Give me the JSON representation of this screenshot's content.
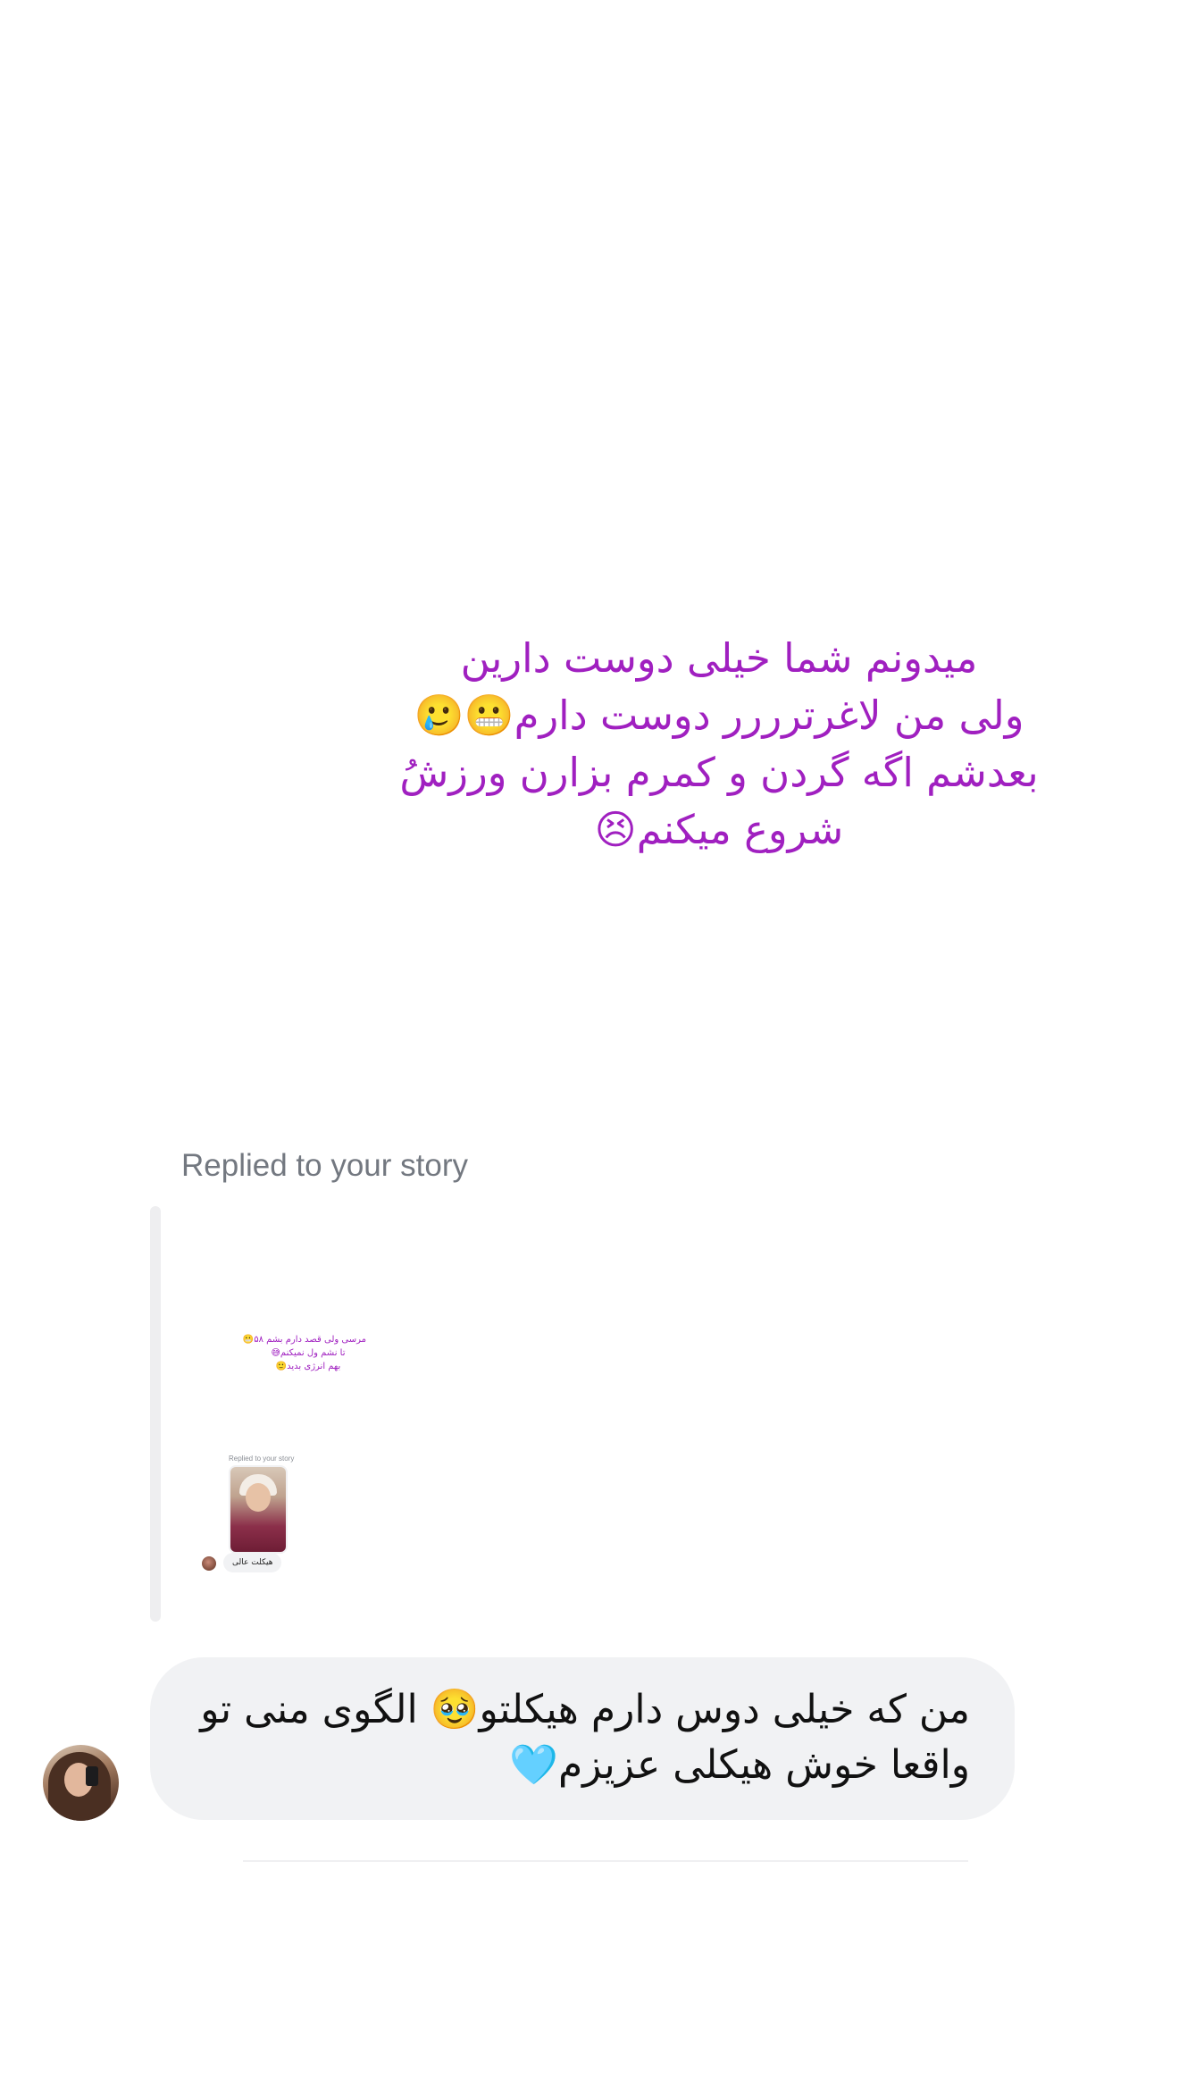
{
  "story": {
    "caption_lines": [
      "میدونم شما خیلی دوست دارین",
      "ولی من لاغرترررر دوست دارم😬🥲",
      "بعدشم اگه گردن و کمرم بزارن ورزشُ",
      "شروع میکنم😣"
    ],
    "caption_color": "#a020c0"
  },
  "reply": {
    "label": "Replied to your story",
    "quoted_preview": {
      "caption_lines": [
        "مرسی ولی قصد دارم بشم ۵۸😬",
        "تا نشم ول نمیکنم😅",
        "بهم انرژی بدید🙂"
      ],
      "replied_label": "Replied to your story",
      "message": "هیکلت عالی"
    }
  },
  "message": {
    "lines": [
      "من که خیلی دوس دارم هیکلتو🥹 الگوی منی تو",
      "واقعا خوش هیکلی عزیزم🩵"
    ],
    "bubble_color": "#f1f2f4"
  }
}
